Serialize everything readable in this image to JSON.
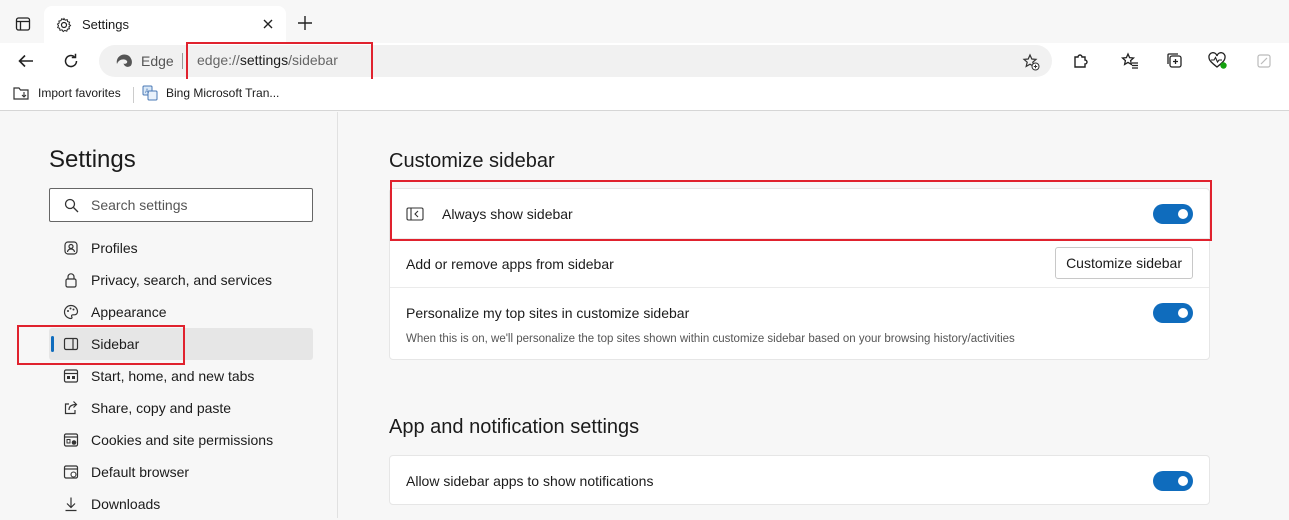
{
  "tab": {
    "title": "Settings"
  },
  "address": {
    "site": "Edge",
    "url_prefix": "edge://",
    "url_bold": "settings",
    "url_suffix": "/sidebar"
  },
  "favorites": [
    {
      "label": "Import favorites",
      "icon": "import-favorites-icon"
    },
    {
      "label": "Bing Microsoft Tran...",
      "icon": "bing-translator-icon"
    }
  ],
  "leftnav": {
    "title": "Settings",
    "search_placeholder": "Search settings",
    "items": [
      {
        "label": "Profiles",
        "icon": "profile-icon",
        "active": false
      },
      {
        "label": "Privacy, search, and services",
        "icon": "lock-icon",
        "active": false
      },
      {
        "label": "Appearance",
        "icon": "palette-icon",
        "active": false
      },
      {
        "label": "Sidebar",
        "icon": "sidebar-icon",
        "active": true
      },
      {
        "label": "Start, home, and new tabs",
        "icon": "home-tabs-icon",
        "active": false
      },
      {
        "label": "Share, copy and paste",
        "icon": "share-icon",
        "active": false
      },
      {
        "label": "Cookies and site permissions",
        "icon": "cookies-icon",
        "active": false
      },
      {
        "label": "Default browser",
        "icon": "browser-icon",
        "active": false
      },
      {
        "label": "Downloads",
        "icon": "download-icon",
        "active": false
      }
    ]
  },
  "main": {
    "section1_title": "Customize sidebar",
    "always_show": {
      "label": "Always show sidebar",
      "enabled": true
    },
    "add_remove": {
      "label": "Add or remove apps from sidebar",
      "button": "Customize sidebar"
    },
    "personalize": {
      "label": "Personalize my top sites in customize sidebar",
      "description": "When this is on, we'll personalize the top sites shown within customize sidebar based on your browsing history/activities",
      "enabled": true
    },
    "section2_title": "App and notification settings",
    "notifications": {
      "label": "Allow sidebar apps to show notifications",
      "enabled": true
    }
  },
  "colors": {
    "accent": "#0f6cbd",
    "highlight": "#e0222e"
  }
}
